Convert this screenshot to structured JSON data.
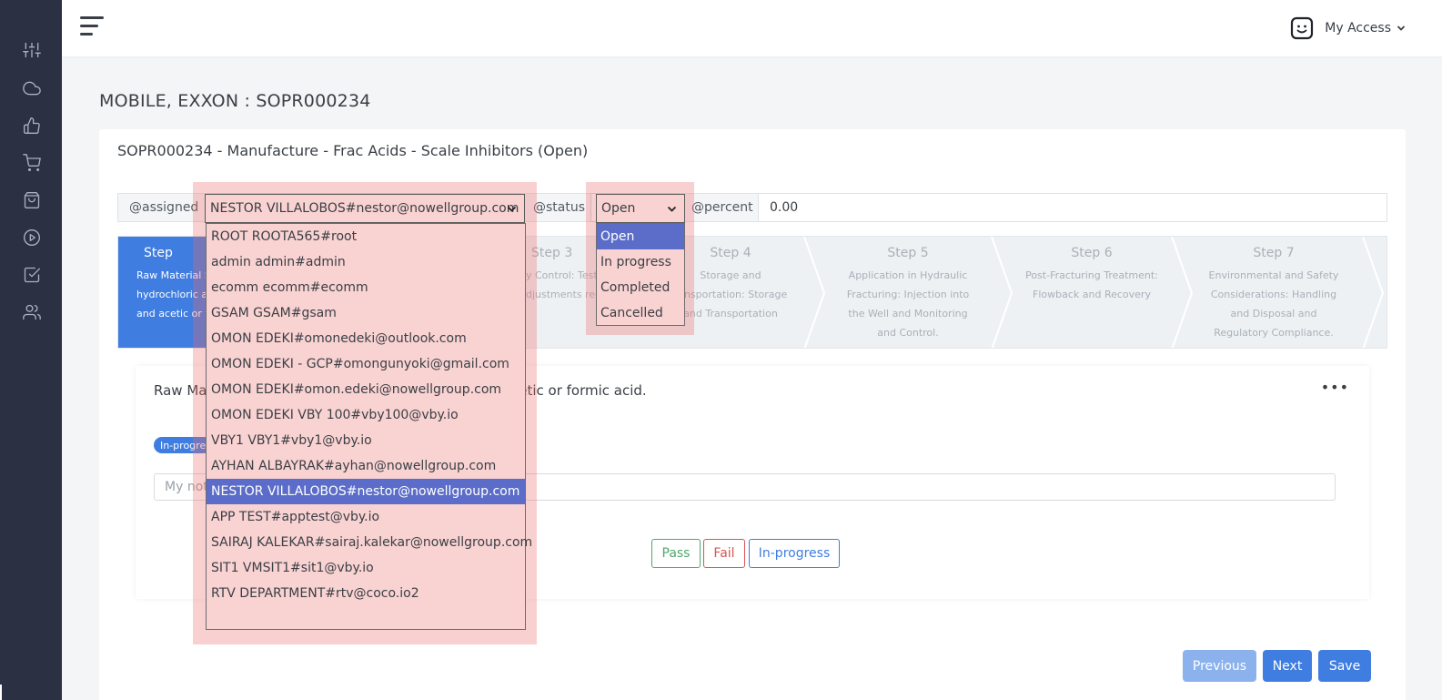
{
  "sidebar": {
    "icons": [
      "sliders-icon",
      "cloud-icon",
      "thumbs-up-icon",
      "shopping-cart-icon",
      "shopping-bag-icon",
      "play-circle-icon",
      "check-square-icon",
      "users-icon"
    ]
  },
  "topbar": {
    "account_label": "My Access"
  },
  "page": {
    "title": "MOBILE, EXXON : SOPR000234"
  },
  "card": {
    "title": "SOPR000234 - Manufacture - Frac Acids - Scale Inhibitors (Open)"
  },
  "fields": {
    "assigned_label": "@assigned",
    "assigned_value": "NESTOR VILLALOBOS#nestor@nowellgroup.com",
    "status_label": "@status",
    "status_value": "Open",
    "percent_label": "@percent",
    "percent_value": "0.00"
  },
  "assigned_options": [
    "ROOT ROOTA565#root",
    "admin admin#admin",
    "ecomm ecomm#ecomm",
    "GSAM GSAM#gsam",
    "OMON EDEKI#omonedeki@outlook.com",
    "OMON EDEKI - GCP#omongunyoki@gmail.com",
    "OMON EDEKI#omon.edeki@nowellgroup.com",
    "OMON EDEKI VBY 100#vby100@vby.io",
    "VBY1 VBY1#vby1@vby.io",
    "AYHAN ALBAYRAK#ayhan@nowellgroup.com",
    "NESTOR VILLALOBOS#nestor@nowellgroup.com",
    "APP TEST#apptest@vby.io",
    "SAIRAJ KALEKAR#sairaj.kalekar@nowellgroup.com",
    "SIT1 VMSIT1#sit1@vby.io",
    "RTV DEPARTMENT#rtv@coco.io2"
  ],
  "assigned_selected_index": 10,
  "status_options": [
    "Open",
    "In progress",
    "Completed",
    "Cancelled"
  ],
  "status_selected_index": 0,
  "steps": [
    {
      "label": "Step",
      "desc": [
        "Raw Material S",
        "hydrochloric a",
        "and acetic or fo"
      ],
      "active": true
    },
    {
      "label": "Step 3",
      "desc": [
        "y Control: Test",
        "djustments requ"
      ],
      "active": false
    },
    {
      "label": "Step 4",
      "desc": [
        "Storage and",
        "ransportation: Storage",
        "and Transportation"
      ],
      "active": false
    },
    {
      "label": "Step 5",
      "desc": [
        "Application in Hydraulic",
        "Fracturing: Injection into",
        "the Well and Monitoring",
        "and Control."
      ],
      "active": false
    },
    {
      "label": "Step 6",
      "desc": [
        "Post-Fracturing Treatment:",
        "Flowback and Recovery"
      ],
      "active": false
    },
    {
      "label": "Step 7",
      "desc": [
        "Environmental and Safety",
        "Considerations: Handling",
        "and Disposal and",
        "Regulatory Compliance."
      ],
      "active": false
    }
  ],
  "step_detail": {
    "title_left": "Raw Ma",
    "title_right": "cetic or formic acid.",
    "badge": "In-progre",
    "notes_placeholder": "My not",
    "menu_icon": "more-horizontal-icon"
  },
  "result_buttons": {
    "pass": "Pass",
    "fail": "Fail",
    "in_progress": "In-progress"
  },
  "nav_buttons": {
    "previous": "Previous",
    "next": "Next",
    "save": "Save"
  },
  "colors": {
    "sidebar_bg": "#2b3142",
    "accent": "#3f7de0",
    "option_highlight": "#5b6dc8",
    "overlay": "#f9d2d2"
  }
}
